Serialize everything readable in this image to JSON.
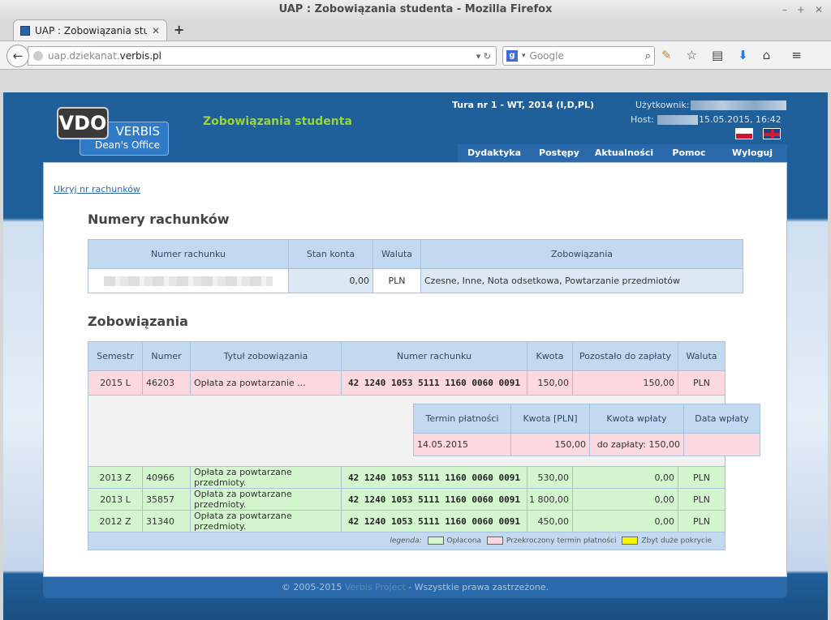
{
  "browser": {
    "window_title": "UAP : Zobowiązania studenta - Mozilla Firefox",
    "window_controls": [
      "–",
      "+",
      "✕"
    ],
    "tab_label": "UAP : Zobowiązania stude...",
    "tab_close": "✕",
    "new_tab": "+",
    "url_prefix": "uap.dziekanat.",
    "url_domain": "verbis.pl",
    "url_icons": "▾ ↻",
    "search_badge": "g",
    "search_placeholder": "Google",
    "icons": [
      "add-on-icon",
      "star-icon",
      "reading-list-icon",
      "download-icon",
      "home-icon",
      "menu-icon"
    ]
  },
  "header": {
    "logo_vdo": "VDO",
    "logo_verbis": "VERBIS",
    "logo_deans": "Dean's Office",
    "page_title": "Zobowiązania studenta",
    "tura": "Tura nr 1 - WT, 2014 (I,D,PL)",
    "user_label": "Użytkownik:",
    "host_label": "Host:",
    "datetime": "15.05.2015, 16:42",
    "menu": [
      "Dydaktyka",
      "Postępy",
      "Aktualności",
      "Pomoc",
      "Wyloguj"
    ]
  },
  "content": {
    "hide_link": "Ukryj nr rachunków",
    "accounts_title": "Numery rachunków",
    "accounts_headers": [
      "Numer rachunku",
      "Stan konta",
      "Waluta",
      "Zobowiązania"
    ],
    "accounts_row": {
      "balance": "0,00",
      "currency": "PLN",
      "obligations": "Czesne, Inne, Nota odsetkowa, Powtarzanie przedmiotów"
    },
    "obligations_title": "Zobowiązania",
    "obligations_headers": [
      "Semestr",
      "Numer",
      "Tytuł zobowiązania",
      "Numer rachunku",
      "Kwota",
      "Pozostało do zapłaty",
      "Waluta"
    ],
    "red_row": [
      "2015 L",
      "46203",
      "Opłata za powtarzanie ...",
      "42 1240 1053 5111 1160 0060 0091",
      "150,00",
      "150,00",
      "PLN"
    ],
    "detail_headers": [
      "Termin płatności",
      "Kwota [PLN]",
      "Kwota wpłaty",
      "Data wpłaty"
    ],
    "detail_row": [
      "14.05.2015",
      "150,00",
      "do zapłaty: 150,00",
      ""
    ],
    "green_rows": [
      [
        "2013 Z",
        "40966",
        "Opłata za powtarzane przedmioty.",
        "42 1240 1053 5111 1160 0060 0091",
        "530,00",
        "0,00",
        "PLN"
      ],
      [
        "2013 L",
        "35857",
        "Opłata za powtarzane przedmioty.",
        "42 1240 1053 5111 1160 0060 0091",
        "1 800,00",
        "0,00",
        "PLN"
      ],
      [
        "2012 Z",
        "31340",
        "Opłata za powtarzane przedmioty.",
        "42 1240 1053 5111 1160 0060 0091",
        "450,00",
        "0,00",
        "PLN"
      ]
    ],
    "legend": {
      "label": "legenda:",
      "paid": "Opłacona",
      "overdue": "Przekroczony termin płatności",
      "overpaid": "Zbyt duże pokrycie",
      "colors": {
        "paid": "#d4f6cf",
        "overdue": "#fbd9de",
        "overpaid": "#f6f600"
      }
    }
  },
  "footer": {
    "prefix": "© 2005-2015",
    "link": "Verbis Project",
    "suffix": "- Wszystkie prawa zastrzeżone."
  }
}
